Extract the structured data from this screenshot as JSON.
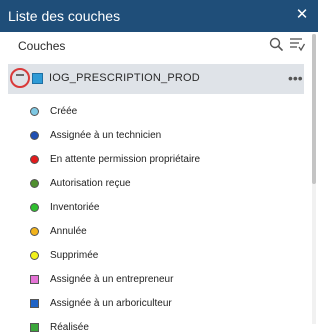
{
  "window": {
    "title": "Liste des couches",
    "close_symbol": "✕"
  },
  "section": {
    "title": "Couches"
  },
  "layer": {
    "name": "IOG_PRESCRIPTION_PROD",
    "more_symbol": "•••"
  },
  "legend": [
    {
      "label": "Créée",
      "color": "#7ec8e3",
      "shape": "circle"
    },
    {
      "label": "Assignée à un technicien",
      "color": "#1f4fb3",
      "shape": "circle"
    },
    {
      "label": "En attente permission propriétaire",
      "color": "#e31a1c",
      "shape": "circle"
    },
    {
      "label": "Autorisation reçue",
      "color": "#4f8f2f",
      "shape": "circle"
    },
    {
      "label": "Inventoriée",
      "color": "#2fbf2f",
      "shape": "circle"
    },
    {
      "label": "Annulée",
      "color": "#f2b31c",
      "shape": "circle"
    },
    {
      "label": "Supprimée",
      "color": "#f2f21c",
      "shape": "circle"
    },
    {
      "label": "Assignée à un entrepreneur",
      "color": "#e573d6",
      "shape": "square"
    },
    {
      "label": "Assignée à un arboriculteur",
      "color": "#1f63c6",
      "shape": "square"
    },
    {
      "label": "Réalisée",
      "color": "#3aa63a",
      "shape": "square"
    }
  ],
  "colors": {
    "titlebar": "#1f4e79",
    "layer_row": "#dfe3e8",
    "highlight_ring": "#d93a3a"
  },
  "icons": [
    "close-icon",
    "search-icon",
    "filter-icon",
    "collapse-icon",
    "layer-icon",
    "more-icon"
  ]
}
